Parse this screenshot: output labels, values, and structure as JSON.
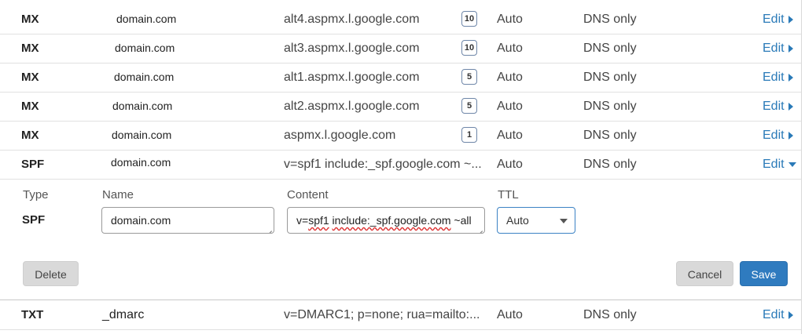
{
  "records": [
    {
      "type": "MX",
      "name": "domain.com",
      "content": "alt4.aspmx.l.google.com",
      "priority": "10",
      "ttl": "Auto",
      "proxy": "DNS only",
      "edit": "Edit"
    },
    {
      "type": "MX",
      "name": "domain.com",
      "content": "alt3.aspmx.l.google.com",
      "priority": "10",
      "ttl": "Auto",
      "proxy": "DNS only",
      "edit": "Edit"
    },
    {
      "type": "MX",
      "name": "domain.com",
      "content": "alt1.aspmx.l.google.com",
      "priority": "5",
      "ttl": "Auto",
      "proxy": "DNS only",
      "edit": "Edit"
    },
    {
      "type": "MX",
      "name": "domain.com",
      "content": "alt2.aspmx.l.google.com",
      "priority": "5",
      "ttl": "Auto",
      "proxy": "DNS only",
      "edit": "Edit"
    },
    {
      "type": "MX",
      "name": "domain.com",
      "content": "aspmx.l.google.com",
      "priority": "1",
      "ttl": "Auto",
      "proxy": "DNS only",
      "edit": "Edit"
    },
    {
      "type": "SPF",
      "name": "domain.com",
      "content": "v=spf1 include:_spf.google.com ~...",
      "ttl": "Auto",
      "proxy": "DNS only",
      "edit": "Edit"
    }
  ],
  "editor": {
    "labels": {
      "type": "Type",
      "name": "Name",
      "content": "Content",
      "ttl": "TTL"
    },
    "type_value": "SPF",
    "name_value": "domain.com",
    "content_prefix": "v=",
    "content_spell1": "spf1",
    "content_mid": " ",
    "content_spell2": "include:_spf.google.com",
    "content_suffix": " ~all",
    "ttl_selected": "Auto",
    "delete_label": "Delete",
    "cancel_label": "Cancel",
    "save_label": "Save"
  },
  "bottom_record": {
    "type": "TXT",
    "name": "_dmarc",
    "content": "v=DMARC1; p=none; rua=mailto:...",
    "ttl": "Auto",
    "proxy": "DNS only",
    "edit": "Edit"
  },
  "colors": {
    "link": "#2a7ab8",
    "save_button": "#2f7bbf",
    "select_border": "#3b82c4"
  }
}
